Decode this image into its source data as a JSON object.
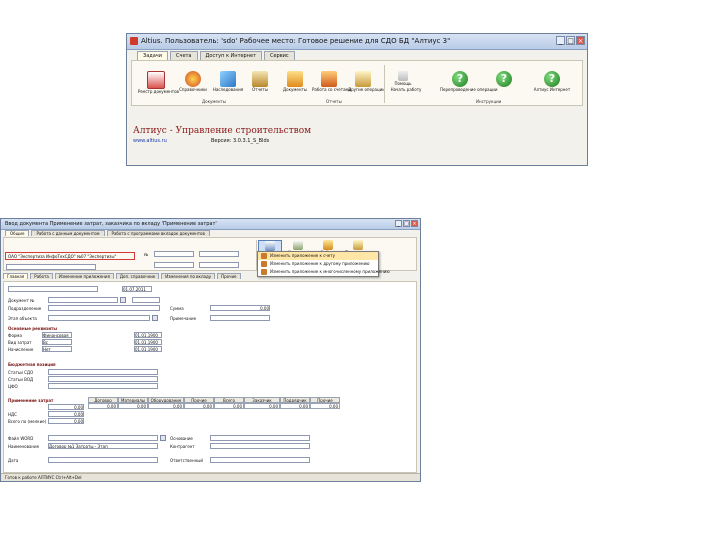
{
  "win1": {
    "title": "Altius. Пользователь: 'sdo' Рабочее место: Готовое решение для СДО БД \"Алтиус 3\"",
    "tabs": [
      "Задачи",
      "Счета",
      "Доступ к Интернет",
      "Сервис"
    ],
    "ribbon": {
      "buttons": [
        "Реестр документов",
        "Справочники",
        "Наследования",
        "Отчеты",
        "Документы",
        "Работа со счетами",
        "Другие операции",
        "Помощь",
        "Начать работу",
        "Перепроведение операции",
        "Алтиус Интернет"
      ],
      "groups": [
        "Документы",
        "Отчеты",
        "Инструкции"
      ],
      "brand": "Алтиус - Управление строительством",
      "url": "www.altius.ru",
      "version": "Версия: 3.0.3.1_S_Blds"
    }
  },
  "win2": {
    "title": "Ввод документа Применение затрат, заказчика по вкладу 'Применение затрат'",
    "tabs": [
      "Общие",
      "Работа с данным документом",
      "Работа с программами вкладок документов"
    ],
    "highlight_text": "ОАО \"Экспертиза ИнфоТехСДО\" №07 \"Экспертизы\"",
    "right_buttons": [
      "Изменить",
      "Изменить",
      "Работа",
      "Проведение"
    ],
    "menu_items": [
      "Изменить приложение к счету",
      "Изменить приложение к другому приложению",
      "Изменить приложение к многочисленному приложению"
    ],
    "subtabs": [
      "Главная",
      "Работа",
      "Изменение приложения",
      "Доп. справочник",
      "Изменения по вкладу",
      "Прочие"
    ],
    "labels": {
      "doc_no": "Документ №",
      "dept": "Подразделение",
      "object": "Этап объекта",
      "section_props": "Основные реквизиты",
      "form": "Форма",
      "type": "Вид затрат",
      "accrual": "Начисление",
      "section_fin": "Бюджетная позиция",
      "cost": "Статьи СДО",
      "cost_code": "Статьи ВОД",
      "sm": "ЦФО",
      "section_app": "Применение затрат",
      "vat": "НДС",
      "total": "Всего по (мелкие)",
      "file": "Файл WORD",
      "name": "Наименование",
      "basis": "Основание",
      "contractor": "Контрагент",
      "responsible": "Ответственный",
      "date": "Дата",
      "sum_label": "Сумма",
      "note": "Примечание"
    },
    "values": {
      "date1": "01.07.2011",
      "date2": "01.01.1900",
      "date3": "01.01.1900",
      "date4": "01.01.1900",
      "amount1": "0,00",
      "amount2": "0,00",
      "amount3": "0,00",
      "name_value": "Договор №1 Затраты - Этап",
      "form_value": "Финансовая",
      "type_value": "Вс",
      "accr_value": "Нет",
      "sum_value": "0,00"
    },
    "grid_headers": [
      "Договор",
      "Материалы",
      "Оборудование",
      "Прочие",
      "Всего",
      "Заказчик",
      "Подрядчик",
      "Прочие"
    ],
    "grid_values": [
      "0,00",
      "0,00",
      "0,00",
      "0,00",
      "0,00",
      "0,00",
      "0,00",
      "0,00"
    ],
    "status_bar": "Готов к работе  АЛТИУС  Ctrl+Alt+Del"
  }
}
